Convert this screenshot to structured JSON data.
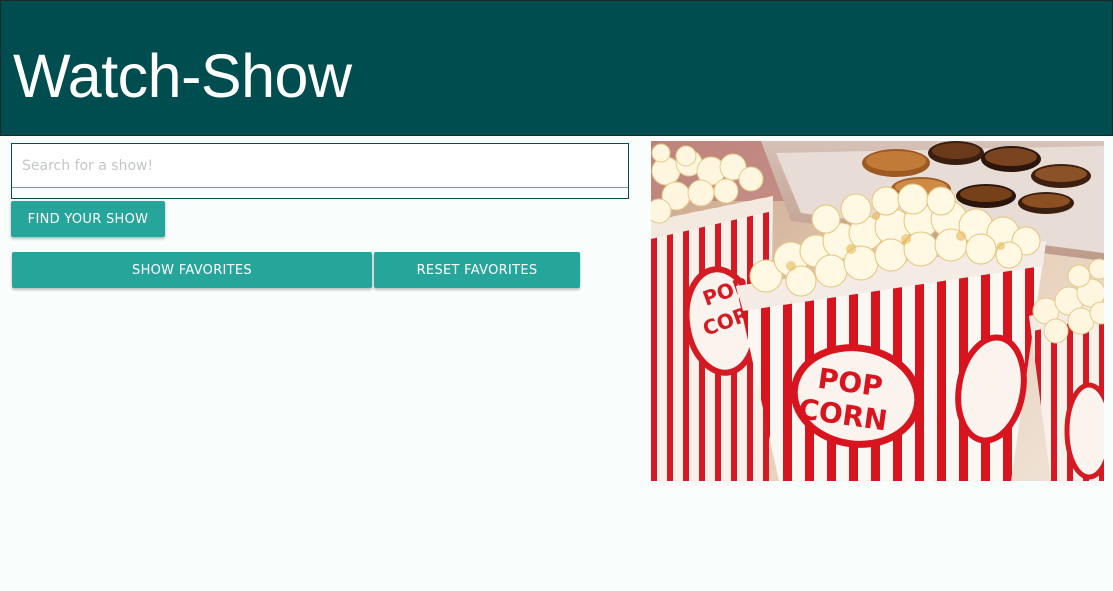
{
  "header": {
    "title": "Watch-Show"
  },
  "search": {
    "placeholder": "Search for a show!",
    "value": ""
  },
  "buttons": {
    "find": "FIND YOUR SHOW",
    "show_favorites": "SHOW FAVORITES",
    "reset_favorites": "RESET FAVORITES"
  },
  "hero": {
    "box_label_line1": "POP",
    "box_label_line2": "CORN"
  },
  "colors": {
    "header_bg": "#004d4f",
    "button_bg": "#26a69a",
    "page_bg": "#f9fefd",
    "popcorn_red": "#d8141f"
  }
}
